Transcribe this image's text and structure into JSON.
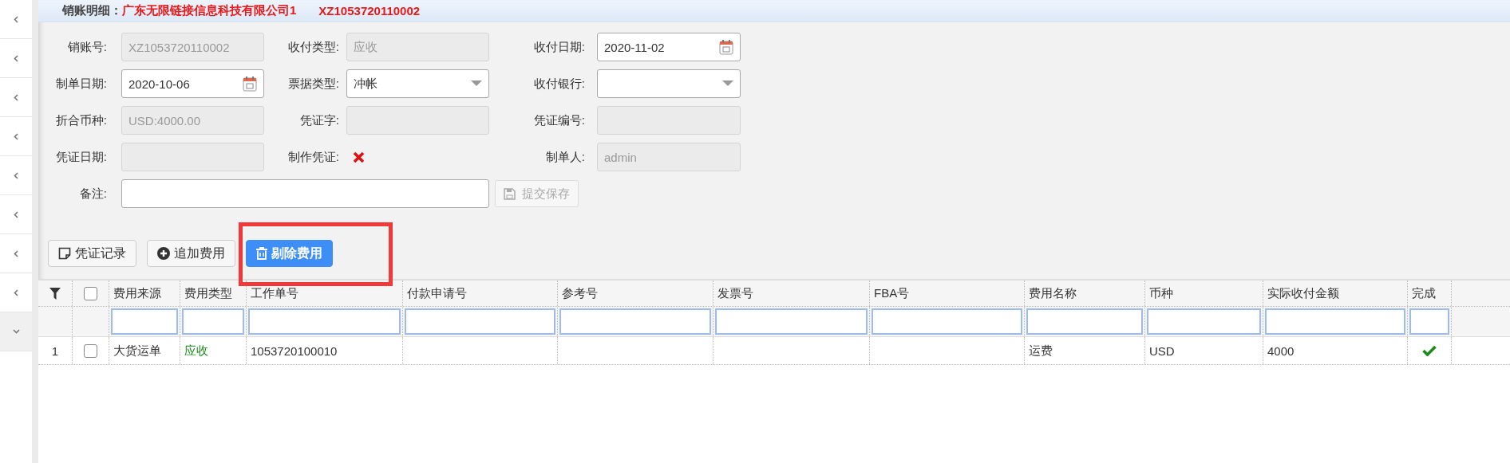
{
  "sidebar": {
    "items": [
      {
        "expanded": false
      },
      {
        "expanded": false
      },
      {
        "expanded": false
      },
      {
        "expanded": false
      },
      {
        "expanded": false
      },
      {
        "expanded": false
      },
      {
        "expanded": false
      },
      {
        "expanded": false
      },
      {
        "expanded": true
      }
    ]
  },
  "header": {
    "label": "销账明细：",
    "company": "广东无限链接信息科技有限公司1",
    "code": "XZ1053720110002"
  },
  "form": {
    "fields": [
      {
        "label": "销账号:",
        "kind": "text",
        "value": "XZ1053720110002",
        "disabled": true
      },
      {
        "label": "收付类型:",
        "kind": "text",
        "value": "应收",
        "disabled": true
      },
      {
        "label": "收付日期:",
        "kind": "date",
        "value": "2020-11-02",
        "disabled": false
      },
      {
        "label": "制单日期:",
        "kind": "date",
        "value": "2020-10-06",
        "disabled": false
      },
      {
        "label": "票据类型:",
        "kind": "select",
        "value": "冲帐",
        "disabled": false
      },
      {
        "label": "收付银行:",
        "kind": "select",
        "disabled": false
      },
      {
        "label": "折合币种:",
        "kind": "text",
        "value": "USD:4000.00",
        "disabled": true
      },
      {
        "label": "凭证字:",
        "kind": "text",
        "disabled": true
      },
      {
        "label": "凭证编号:",
        "kind": "text",
        "disabled": true
      },
      {
        "label": "凭证日期:",
        "kind": "text",
        "disabled": true
      },
      {
        "label": "制作凭证:",
        "kind": "flag",
        "done": false
      },
      {
        "label": "制单人:",
        "kind": "text",
        "value": "admin",
        "disabled": true
      },
      {
        "label": "备注:",
        "kind": "wide",
        "disabled": false
      }
    ],
    "submit": {
      "label": "提交保存",
      "disabled": true
    }
  },
  "toolbar": {
    "buttons": [
      {
        "label": "凭证记录",
        "kind": "note",
        "primary": false
      },
      {
        "label": "追加费用",
        "kind": "add",
        "primary": false
      },
      {
        "label": "剔除费用",
        "kind": "trash",
        "primary": true
      }
    ]
  },
  "table": {
    "header_checked": false,
    "columns": [
      "费用来源",
      "费用类型",
      "工作单号",
      "付款申请号",
      "参考号",
      "发票号",
      "FBA号",
      "费用名称",
      "币种",
      "实际收付金额",
      "完成"
    ],
    "rows": [
      {
        "number": "1",
        "checked": false,
        "source": "大货运单",
        "type": "应收",
        "job_no": "1053720100010",
        "fee_name": "运费",
        "currency": "USD",
        "amount": "4000",
        "done": true
      }
    ]
  }
}
